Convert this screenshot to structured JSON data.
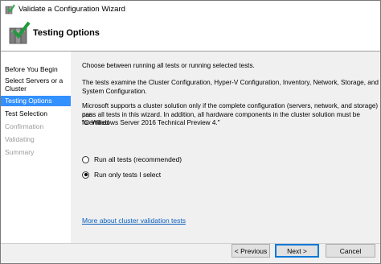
{
  "window": {
    "title": "Validate a Configuration Wizard"
  },
  "header": {
    "title": "Testing Options"
  },
  "sidebar": {
    "items": [
      {
        "label": "Before You Begin",
        "state": "normal"
      },
      {
        "label": "Select Servers or a",
        "label2": "Cluster",
        "state": "normal"
      },
      {
        "label": "Testing Options",
        "state": "active"
      },
      {
        "label": "Test Selection",
        "state": "normal"
      },
      {
        "label": "Confirmation",
        "state": "disabled"
      },
      {
        "label": "Validating",
        "state": "disabled"
      },
      {
        "label": "Summary",
        "state": "disabled"
      }
    ]
  },
  "content": {
    "intro": "Choose between running all tests or running selected tests.",
    "desc_line1": "The tests examine the Cluster Configuration, Hyper-V Configuration, Inventory, Network, Storage, and",
    "desc_line2": "System Configuration.",
    "support_line1": "Microsoft supports a cluster solution only if the complete configuration (servers, network, and storage) can",
    "support_line2": "pass all tests in this wizard. In addition, all hardware components in the cluster solution must be \"Certified",
    "support_line3": "for Windows Server 2016 Technical Preview 4.\"",
    "options": [
      {
        "label": "Run all tests (recommended)",
        "checked": false
      },
      {
        "label": "Run only tests I select",
        "checked": true
      }
    ],
    "link": "More about cluster validation tests"
  },
  "footer": {
    "previous_label": "< Previous",
    "next_label": "Next >",
    "cancel_label": "Cancel"
  },
  "colors": {
    "accent": "#3390ff",
    "link": "#0b5fbf",
    "content_bg": "#f0f0f0"
  },
  "icons": {
    "title": "cluster-validation-icon",
    "header": "cluster-checkmark-icon"
  }
}
